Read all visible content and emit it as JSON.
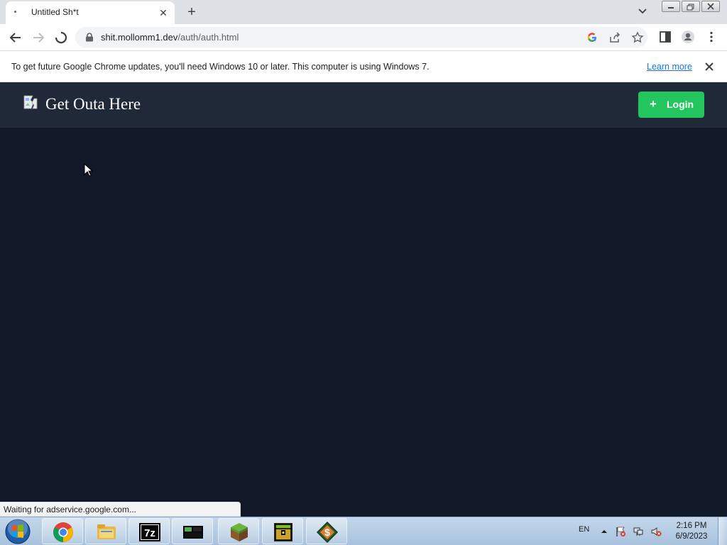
{
  "browser": {
    "tab_title": "Untitled Sh*t",
    "url_host": "shit.mollomm1.dev",
    "url_path": "/auth/auth.html",
    "infobar_text": "To get future Google Chrome updates, you'll need Windows 10 or later. This computer is using Windows 7.",
    "infobar_link": "Learn more",
    "status_text": "Waiting for adservice.google.com..."
  },
  "site": {
    "title": "Get Outa Here",
    "login_label": "Login",
    "login_icon": "plus-icon",
    "header_color": "#1f2937",
    "background_color": "#111827",
    "accent_color": "#22c55e"
  },
  "taskbar": {
    "language": "EN",
    "time": "2:16 PM",
    "date": "6/9/2023",
    "apps": [
      "chrome-icon",
      "file-explorer-icon",
      "7zip-icon",
      "terminal-app-icon",
      "minecraft-icon",
      "treasure-chest-app-icon",
      "dollar-app-icon"
    ]
  }
}
